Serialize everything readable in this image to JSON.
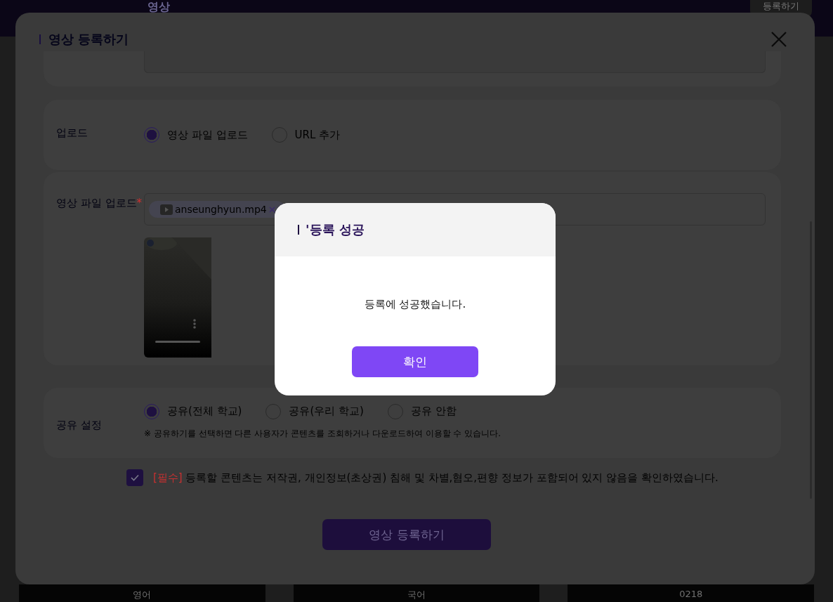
{
  "background_page": {
    "nav_items": [
      {
        "label": "영상",
        "selected": true
      }
    ],
    "register_button": "등록하기",
    "bottom_cells": [
      "영어",
      "국어",
      "0218"
    ]
  },
  "modal": {
    "title": "영상 등록하기",
    "upload": {
      "label": "업로드",
      "options": [
        {
          "label": "영상 파일 업로드",
          "selected": true
        },
        {
          "label": "URL 추가",
          "selected": false
        }
      ]
    },
    "file": {
      "label": "영상 파일 업로드",
      "required": true,
      "required_mark": "*",
      "files": [
        {
          "name": "anseunghyun.mp4"
        }
      ]
    },
    "share": {
      "label": "공유 설정",
      "options": [
        {
          "label": "공유(전체 학교)",
          "selected": true
        },
        {
          "label": "공유(우리 학교)",
          "selected": false
        },
        {
          "label": "공유 안함",
          "selected": false
        }
      ],
      "note": "※ 공유하기를 선택하면 다른 사용자가 콘텐츠를 조회하거나 다운로드하여 이용할 수 있습니다."
    },
    "agreement": {
      "checked": true,
      "tag": "[필수]",
      "text": "등록할 콘텐츠는 저작권, 개인정보(초상권) 침해 및 차별,혐오,편향 정보가 포함되어 있지 않음을 확인하였습니다."
    },
    "submit_button": "영상 등록하기"
  },
  "dialog": {
    "title": "'등록 성공",
    "message": "등록에 성공했습니다.",
    "confirm_button": "확인"
  }
}
